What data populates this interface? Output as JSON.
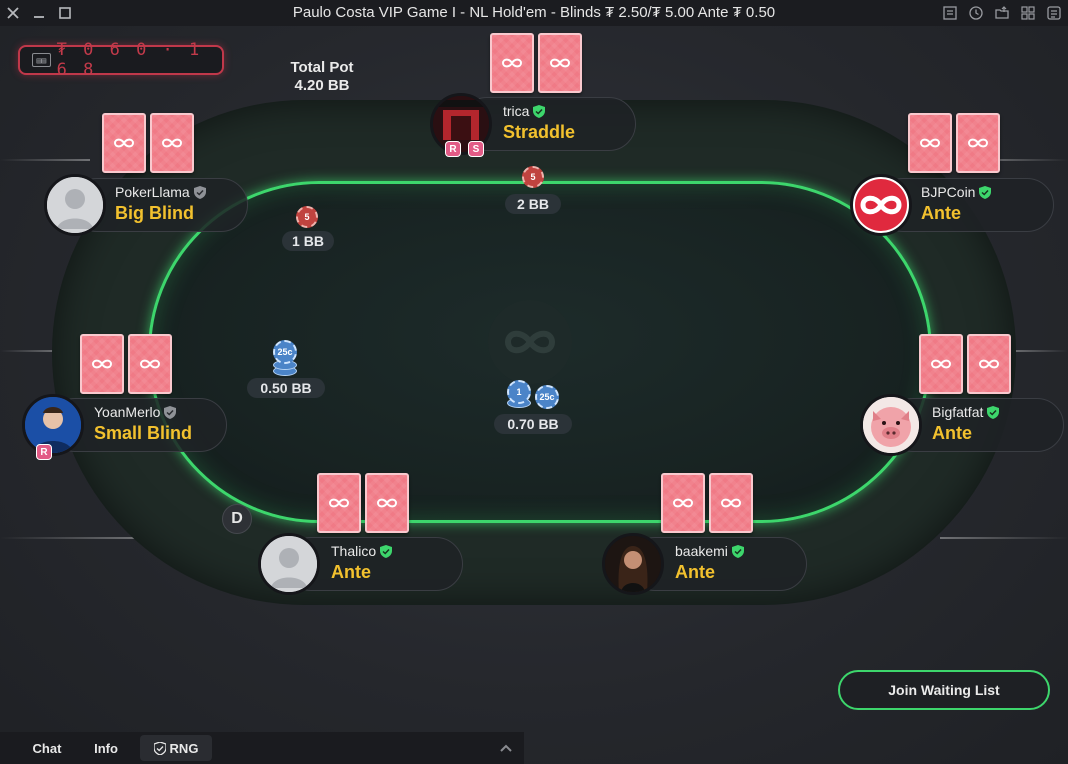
{
  "window": {
    "title": "Paulo Costa VIP Game I - NL Hold'em - Blinds ₮ 2.50/₮ 5.00 Ante ₮ 0.50"
  },
  "balance": {
    "icon": "wallet-icon",
    "value": "₮ 0 6 0 · 1 6 8"
  },
  "pot": {
    "label": "Total Pot",
    "value": "4.20 BB"
  },
  "players": {
    "trica": {
      "name": "trica",
      "status": "Straddle",
      "verified": true,
      "badges": [
        "R",
        "S"
      ]
    },
    "pokerllama": {
      "name": "PokerLlama",
      "status": "Big Blind",
      "verified": false
    },
    "bjpcoin": {
      "name": "BJPCoin",
      "status": "Ante",
      "verified": true
    },
    "yoanmerlo": {
      "name": "YoanMerlo",
      "status": "Small Blind",
      "verified": false,
      "badges": [
        "R"
      ]
    },
    "bigfatfat": {
      "name": "Bigfatfat",
      "status": "Ante",
      "verified": true
    },
    "thalico": {
      "name": "Thalico",
      "status": "Ante",
      "verified": true
    },
    "baakemi": {
      "name": "baakemi",
      "status": "Ante",
      "verified": true
    }
  },
  "bets": {
    "trica": {
      "amount": "2 BB",
      "chip": "5"
    },
    "pokerllama": {
      "amount": "1 BB",
      "chip": "5"
    },
    "yoanmerlo": {
      "amount": "0.50 BB",
      "chip": "25c"
    },
    "center": {
      "amount": "0.70 BB",
      "chips": [
        "1",
        "25c"
      ]
    }
  },
  "dealer_button": "D",
  "actions": {
    "join_waiting_list": "Join Waiting List"
  },
  "bottom_tabs": {
    "chat": "Chat",
    "info": "Info",
    "rng": "RNG"
  },
  "colors": {
    "felt_rail": "#3dd66c",
    "card_back": "#f07a86",
    "status_text": "#f2c12e",
    "balance_border": "#c0384a"
  }
}
